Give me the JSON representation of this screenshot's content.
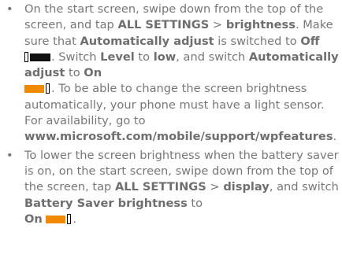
{
  "bullet_char": "•",
  "colors": {
    "text": "#777777",
    "accent_toggle_on": "#f08a00",
    "toggle_off_track": "#111111"
  },
  "icons": {
    "toggle_off": "switch-off-icon",
    "toggle_on": "switch-on-icon"
  },
  "items": [
    {
      "t1": "On the start screen, swipe down from the top of the screen, and tap ",
      "b1": "ALL SETTINGS",
      "t2": " > ",
      "b2": "brightness",
      "t3": ". Make sure that ",
      "b3": "Automatically adjust",
      "t4": " is switched to ",
      "b4": "Off",
      "t5": ". Switch ",
      "b5": "Level",
      "t6": " to ",
      "b6": "low",
      "t7": ", and switch ",
      "b7": "Automatically adjust",
      "t8": " to ",
      "b8": "On",
      "t9": ". To be able to change the screen brightness automatically, your phone must have a light sensor. For availability, go to ",
      "b9": "www.microsoft.com/mobile/support/wpfeatures",
      "t10": "."
    },
    {
      "t1": "To lower the screen brightness when the battery saver is on, on the start screen, swipe down from the top of the screen, tap ",
      "b1": "ALL SETTINGS",
      "t2": " > ",
      "b2": "display",
      "t3": ", and switch ",
      "b3": "Battery Saver brightness",
      "t4": " to ",
      "b4": "On",
      "t5": "."
    }
  ]
}
